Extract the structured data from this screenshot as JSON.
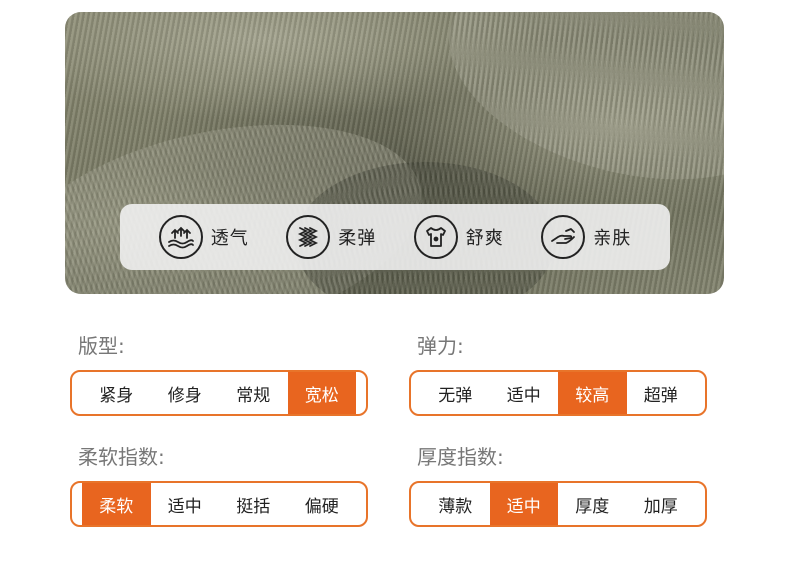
{
  "features": [
    {
      "label": "透气",
      "icon": "airflow-icon"
    },
    {
      "label": "柔弹",
      "icon": "wave-stretch-icon"
    },
    {
      "label": "舒爽",
      "icon": "shirt-icon"
    },
    {
      "label": "亲肤",
      "icon": "hand-icon"
    }
  ],
  "groups": [
    {
      "title": "版型:",
      "options": [
        "紧身",
        "修身",
        "常规",
        "宽松"
      ],
      "selected": 3
    },
    {
      "title": "弹力:",
      "options": [
        "无弹",
        "适中",
        "较高",
        "超弹"
      ],
      "selected": 2
    },
    {
      "title": "柔软指数:",
      "options": [
        "柔软",
        "适中",
        "挺括",
        "偏硬"
      ],
      "selected": 0
    },
    {
      "title": "厚度指数:",
      "options": [
        "薄款",
        "适中",
        "厚度",
        "加厚"
      ],
      "selected": 1
    }
  ],
  "colors": {
    "accent": "#e8651f",
    "border": "#e8742a"
  }
}
